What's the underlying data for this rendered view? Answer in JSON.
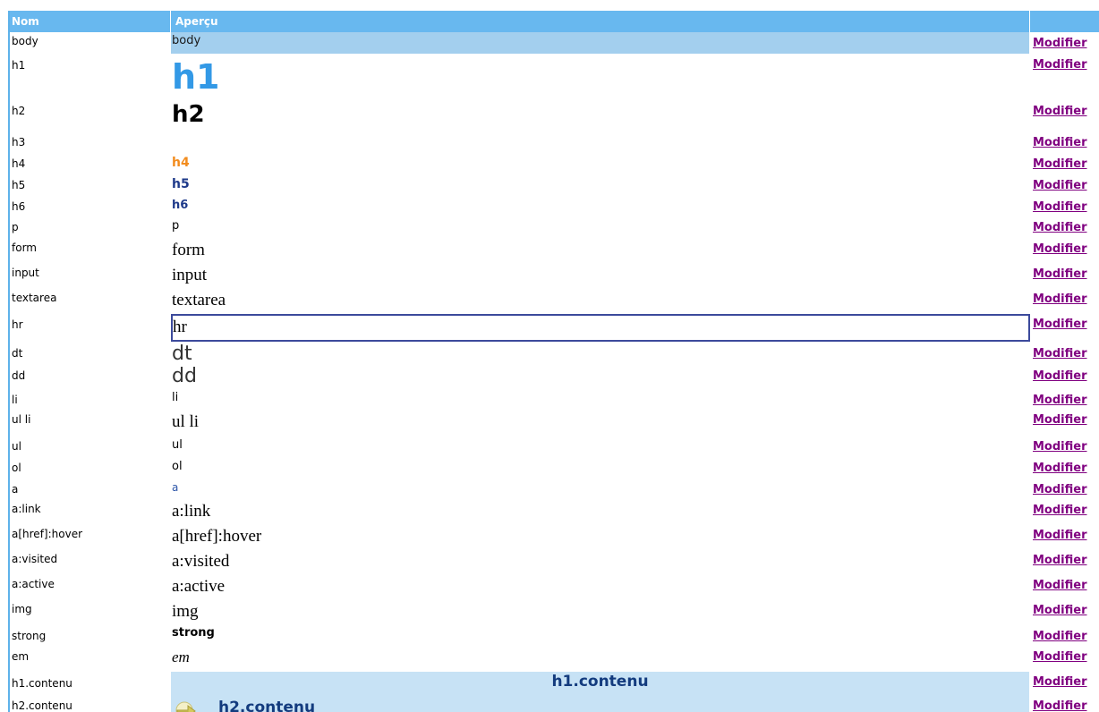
{
  "table": {
    "headers": {
      "nom": "Nom",
      "apercu": "Aperçu",
      "actions": ""
    },
    "action_label": "Modifier",
    "rows": [
      {
        "name": "body",
        "preview": "body"
      },
      {
        "name": "h1",
        "preview": "h1"
      },
      {
        "name": "h2",
        "preview": "h2"
      },
      {
        "name": "h3",
        "preview": ""
      },
      {
        "name": "h4",
        "preview": "h4"
      },
      {
        "name": "h5",
        "preview": "h5"
      },
      {
        "name": "h6",
        "preview": "h6"
      },
      {
        "name": "p",
        "preview": "p"
      },
      {
        "name": "form",
        "preview": "form"
      },
      {
        "name": "input",
        "preview": "input"
      },
      {
        "name": "textarea",
        "preview": "textarea"
      },
      {
        "name": "hr",
        "preview": "hr"
      },
      {
        "name": "dt",
        "preview": "dt"
      },
      {
        "name": "dd",
        "preview": "dd"
      },
      {
        "name": "li",
        "preview": "li"
      },
      {
        "name": "ul li",
        "preview": "ul li"
      },
      {
        "name": "ul",
        "preview": "ul"
      },
      {
        "name": "ol",
        "preview": "ol"
      },
      {
        "name": "a",
        "preview": "a"
      },
      {
        "name": "a:link",
        "preview": "a:link"
      },
      {
        "name": "a[href]:hover",
        "preview": "a[href]:hover"
      },
      {
        "name": "a:visited",
        "preview": "a:visited"
      },
      {
        "name": "a:active",
        "preview": "a:active"
      },
      {
        "name": "img",
        "preview": "img"
      },
      {
        "name": "strong",
        "preview": "strong"
      },
      {
        "name": "em",
        "preview": "em"
      },
      {
        "name": "h1.contenu",
        "preview": "h1.contenu"
      },
      {
        "name": "h2.contenu",
        "preview": "h2.contenu"
      }
    ]
  },
  "colors": {
    "header_bg": "#68b8ef",
    "link": "#800080",
    "h1": "#3399e6",
    "h4": "#f28c1e",
    "h5_h6": "#1e3a8a",
    "content_bg": "#c7e2f5",
    "content_title": "#133b7e"
  },
  "icons": {
    "h2_contenu": "arrow-right-icon"
  }
}
